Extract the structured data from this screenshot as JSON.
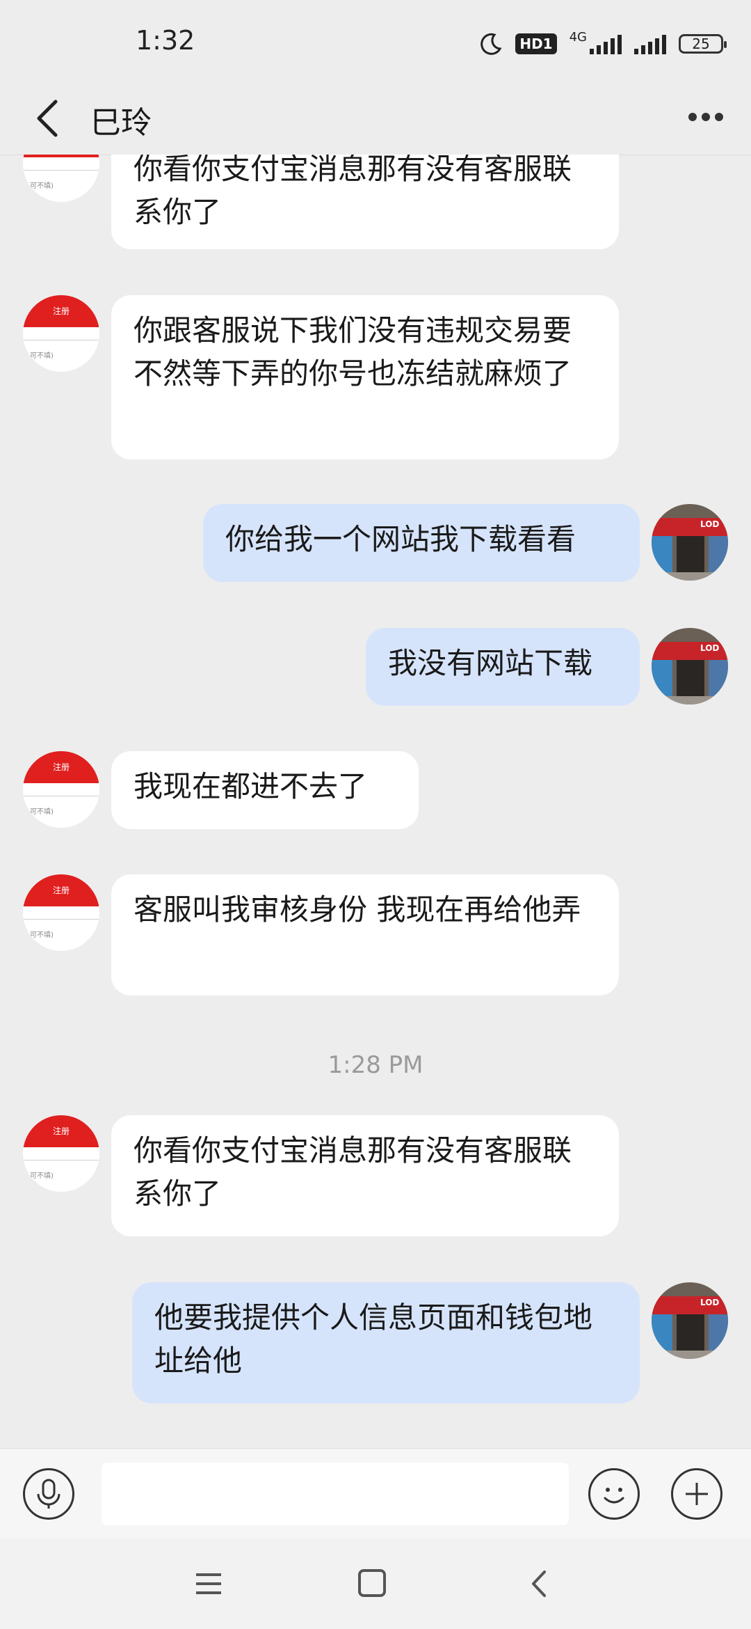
{
  "status_bar": {
    "time": "1:32",
    "hd_label": "HD1",
    "network": "4G",
    "battery": "25"
  },
  "header": {
    "title": "巳玲"
  },
  "messages": [
    {
      "side": "in",
      "text": "你看你支付宝消息那有没有客服联系你了"
    },
    {
      "side": "in",
      "text": "你跟客服说下我们没有违规交易要不然等下弄的你号也冻结就麻烦了"
    },
    {
      "side": "out",
      "text": "你给我一个网站我下载看看"
    },
    {
      "side": "out",
      "text": "我没有网站下载"
    },
    {
      "side": "in",
      "text": "我现在都进不去了"
    },
    {
      "side": "in",
      "text": "客服叫我审核身份 我现在再给他弄"
    },
    {
      "side": "in",
      "text": "你看你支付宝消息那有没有客服联系你了"
    },
    {
      "side": "out",
      "text": "他要我提供个人信息页面和钱包地址给他"
    }
  ],
  "timestamp": "1:28 PM",
  "avatar_in": {
    "top_text": "注册",
    "bottom_text": "可不填)"
  },
  "avatar_out": {
    "sign_text": "LOD"
  },
  "input_bar": {
    "text_value": ""
  },
  "colors": {
    "background": "#ededed",
    "incoming_bubble": "#ffffff",
    "outgoing_bubble": "#d6e4fb",
    "avatar_red": "#e01f1f"
  },
  "icons": [
    "back-arrow-icon",
    "more-dots-icon",
    "microphone-icon",
    "emoji-icon",
    "plus-icon",
    "menu-icon",
    "home-square-icon",
    "back-nav-icon",
    "moon-icon",
    "signal-icon",
    "battery-icon"
  ]
}
